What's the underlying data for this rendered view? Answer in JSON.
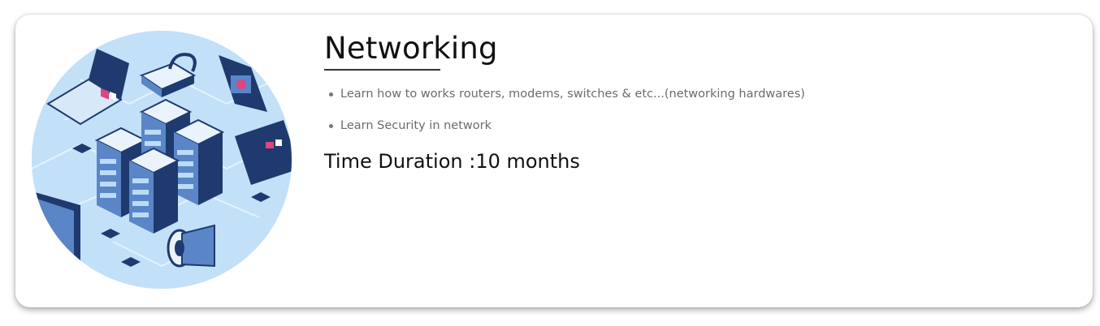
{
  "course": {
    "title": "Networking",
    "points": [
      "Learn how to works routers, modems, switches & etc...(networking hardwares)",
      "Learn Security in network"
    ],
    "duration_label": "Time Duration :",
    "duration_value": "10 months"
  },
  "illustration": {
    "icon": "network-isometric-illustration",
    "colors": {
      "background": "#bcdcf6",
      "dark": "#1e3a6e",
      "mid": "#5a86c8",
      "accent_pink": "#e0457b"
    }
  }
}
